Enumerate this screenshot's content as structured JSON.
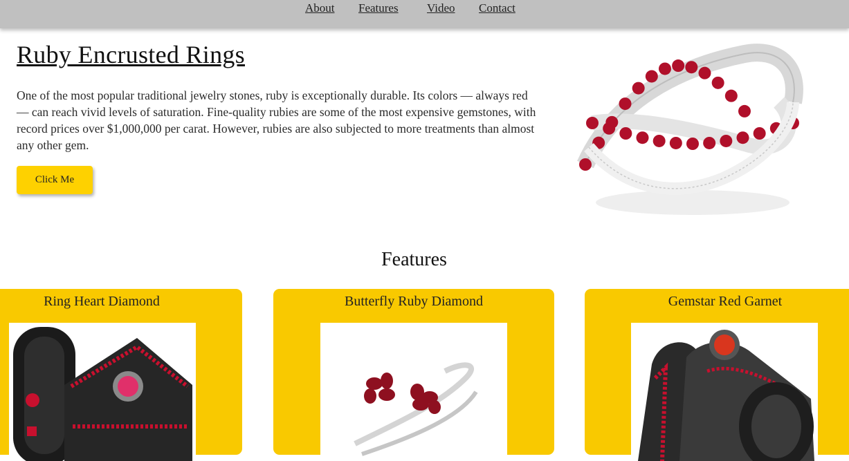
{
  "nav": {
    "items": [
      "About",
      "Features",
      "Video",
      "Contact"
    ]
  },
  "hero": {
    "title": "Ruby Encrusted Rings",
    "text": "One of the most popular traditional jewelry stones, ruby is exceptionally durable. Its colors — always red — can reach vivid levels of saturation. Fine-quality rubies are some of the most expensive gemstones, with record prices over $1,000,000 per carat. However, rubies are also subjected to more treatments than almost any other gem.",
    "button": "Click Me"
  },
  "features": {
    "title": "Features",
    "cards": [
      {
        "title": "Ring Heart Diamond"
      },
      {
        "title": "Butterfly Ruby Diamond"
      },
      {
        "title": "Gemstar Red Garnet"
      }
    ]
  },
  "colors": {
    "nav_bg": "#c0c0c0",
    "accent": "#fed100",
    "card_bg": "#f9c900",
    "ruby": "#b0102a"
  }
}
